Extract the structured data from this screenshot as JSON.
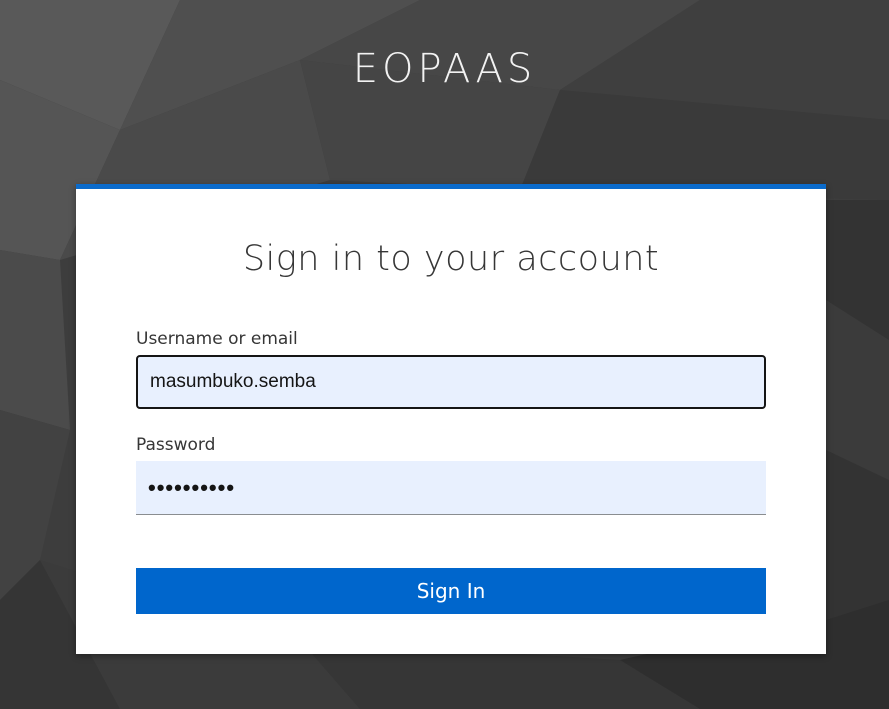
{
  "header": {
    "brand": "EOPAAS"
  },
  "login": {
    "title": "Sign in to your account",
    "username_label": "Username or email",
    "username_value": "masumbuko.semba",
    "password_label": "Password",
    "password_value": "••••••••••",
    "submit_label": "Sign In"
  },
  "colors": {
    "accent": "#0066cc",
    "card_top_border": "#0b6bcb",
    "background": "#3a3a3a",
    "input_fill": "#e8f0fe"
  }
}
